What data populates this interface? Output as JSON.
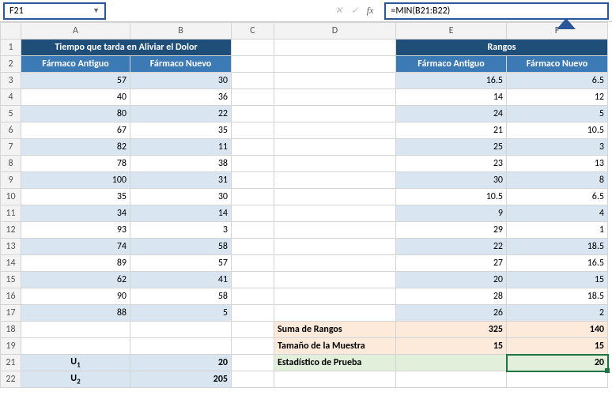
{
  "formula_bar": {
    "name_box": "F21",
    "formula": "=MIN(B21:B22)"
  },
  "columns": [
    "A",
    "B",
    "C",
    "D",
    "E",
    "F"
  ],
  "left_table": {
    "title": "Tiempo que tarda en Aliviar el Dolor",
    "h1": "Fármaco Antiguo",
    "h2": "Fármaco Nuevo",
    "rows": [
      {
        "a": "57",
        "b": "30"
      },
      {
        "a": "40",
        "b": "36"
      },
      {
        "a": "80",
        "b": "22"
      },
      {
        "a": "67",
        "b": "35"
      },
      {
        "a": "82",
        "b": "11"
      },
      {
        "a": "78",
        "b": "38"
      },
      {
        "a": "100",
        "b": "31"
      },
      {
        "a": "35",
        "b": "30"
      },
      {
        "a": "34",
        "b": "14"
      },
      {
        "a": "93",
        "b": "3"
      },
      {
        "a": "74",
        "b": "58"
      },
      {
        "a": "89",
        "b": "57"
      },
      {
        "a": "62",
        "b": "41"
      },
      {
        "a": "90",
        "b": "58"
      },
      {
        "a": "88",
        "b": "5"
      }
    ]
  },
  "right_table": {
    "title": "Rangos",
    "h1": "Fármaco Antiguo",
    "h2": "Fármaco Nuevo",
    "rows": [
      {
        "e": "16.5",
        "f": "6.5"
      },
      {
        "e": "14",
        "f": "12"
      },
      {
        "e": "24",
        "f": "5"
      },
      {
        "e": "21",
        "f": "10.5"
      },
      {
        "e": "25",
        "f": "3"
      },
      {
        "e": "23",
        "f": "13"
      },
      {
        "e": "30",
        "f": "8"
      },
      {
        "e": "10.5",
        "f": "6.5"
      },
      {
        "e": "9",
        "f": "4"
      },
      {
        "e": "29",
        "f": "1"
      },
      {
        "e": "22",
        "f": "18.5"
      },
      {
        "e": "27",
        "f": "16.5"
      },
      {
        "e": "20",
        "f": "15"
      },
      {
        "e": "28",
        "f": "18.5"
      },
      {
        "e": "26",
        "f": "2"
      }
    ]
  },
  "summary": {
    "sum_label": "Suma de Rangos",
    "sum_e": "325",
    "sum_f": "140",
    "size_label": "Tamaño de la Muestra",
    "size_e": "15",
    "size_f": "15",
    "stat_label": "Estadístico de Prueba",
    "stat_f": "20"
  },
  "u": {
    "u1_label": "U",
    "u1_sub": "1",
    "u1_val": "20",
    "u2_label": "U",
    "u2_sub": "2",
    "u2_val": "205"
  }
}
